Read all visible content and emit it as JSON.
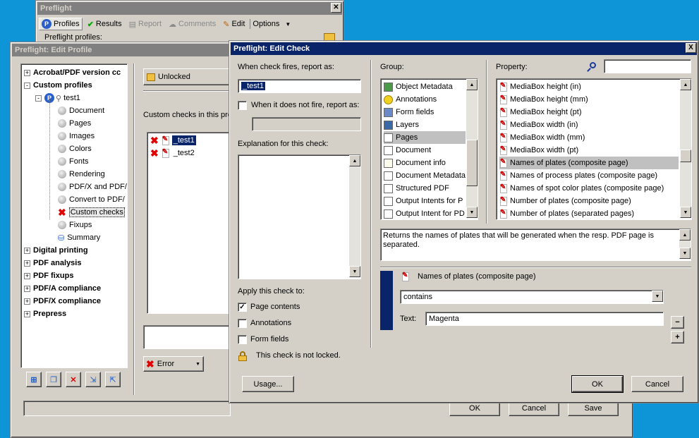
{
  "bg_window": {
    "title": "Preflight",
    "toolbar": {
      "profiles": "Profiles",
      "results": "Results",
      "report": "Report",
      "comments": "Comments",
      "edit": "Edit",
      "options": "Options"
    },
    "profiles_label": "Preflight profiles:"
  },
  "edit_profile": {
    "title": "Preflight: Edit Profile",
    "tree": [
      {
        "label": "Acrobat/PDF version cc",
        "bold": true,
        "level": 0,
        "expander": "+"
      },
      {
        "label": "Custom profiles",
        "bold": true,
        "level": 0,
        "expander": "-"
      },
      {
        "label": "test1",
        "bold": false,
        "level": 1,
        "expander": "-"
      },
      {
        "label": "Document",
        "level": 2
      },
      {
        "label": "Pages",
        "level": 2
      },
      {
        "label": "Images",
        "level": 2
      },
      {
        "label": "Colors",
        "level": 2
      },
      {
        "label": "Fonts",
        "level": 2
      },
      {
        "label": "Rendering",
        "level": 2
      },
      {
        "label": "PDF/X and PDF/",
        "level": 2
      },
      {
        "label": "Convert to PDF/",
        "level": 2
      },
      {
        "label": "Custom checks",
        "level": 2
      },
      {
        "label": "Fixups",
        "level": 2
      },
      {
        "label": "Summary",
        "level": 2
      },
      {
        "label": "Digital printing",
        "bold": true,
        "level": 0,
        "expander": "+"
      },
      {
        "label": "PDF analysis",
        "bold": true,
        "level": 0,
        "expander": "+"
      },
      {
        "label": "PDF fixups",
        "bold": true,
        "level": 0,
        "expander": "+"
      },
      {
        "label": "PDF/A compliance",
        "bold": true,
        "level": 0,
        "expander": "+"
      },
      {
        "label": "PDF/X compliance",
        "bold": true,
        "level": 0,
        "expander": "+"
      },
      {
        "label": "Prepress",
        "bold": true,
        "level": 0,
        "expander": "+"
      }
    ],
    "unlocked_label": "Unlocked",
    "custom_checks_label": "Custom checks in this pro",
    "checks": [
      "_test1",
      "_test2"
    ],
    "error_dropdown": "Error",
    "ok": "OK",
    "cancel": "Cancel",
    "save": "Save"
  },
  "edit_check": {
    "title": "Preflight: Edit Check",
    "close_glyph": "X",
    "fires_label": "When check fires, report as:",
    "fires_value": "_test1",
    "not_fire_label": "When it does not fire, report as:",
    "explanation_label": "Explanation for this check:",
    "apply_label": "Apply this check to:",
    "apply_items": [
      {
        "label": "Page contents",
        "checked": true
      },
      {
        "label": "Annotations",
        "checked": false
      },
      {
        "label": "Form fields",
        "checked": false
      }
    ],
    "not_locked_label": "This check is not locked.",
    "usage_btn": "Usage...",
    "group_label": "Group:",
    "groups": [
      "Object Metadata",
      "Annotations",
      "Form fields",
      "Layers",
      "Pages",
      "Document",
      "Document info",
      "Document Metadata",
      "Structured PDF",
      "Output Intents for P",
      "Output Intent for PD"
    ],
    "group_selected": "Pages",
    "property_label": "Property:",
    "properties": [
      "MediaBox height (in)",
      "MediaBox height (mm)",
      "MediaBox height (pt)",
      "MediaBox width (in)",
      "MediaBox width (mm)",
      "MediaBox width (pt)",
      "Names of plates (composite page)",
      "Names of process plates (composite page)",
      "Names of spot color plates (composite page)",
      "Number of plates (composite page)",
      "Number of plates (separated pages)"
    ],
    "property_selected": "Names of plates (composite page)",
    "description": "Returns the names of plates that will be generated when the resp. PDF page is separated.",
    "condition": {
      "property": "Names of plates (composite page)",
      "operator": "contains",
      "text_label": "Text:",
      "text_value": "Magenta"
    },
    "minus": "−",
    "plus": "+",
    "ok": "OK",
    "cancel": "Cancel"
  },
  "colors": {
    "titlebar_active": "#0a246a",
    "desktop": "#0d95d8",
    "selection": "#0a246a"
  }
}
